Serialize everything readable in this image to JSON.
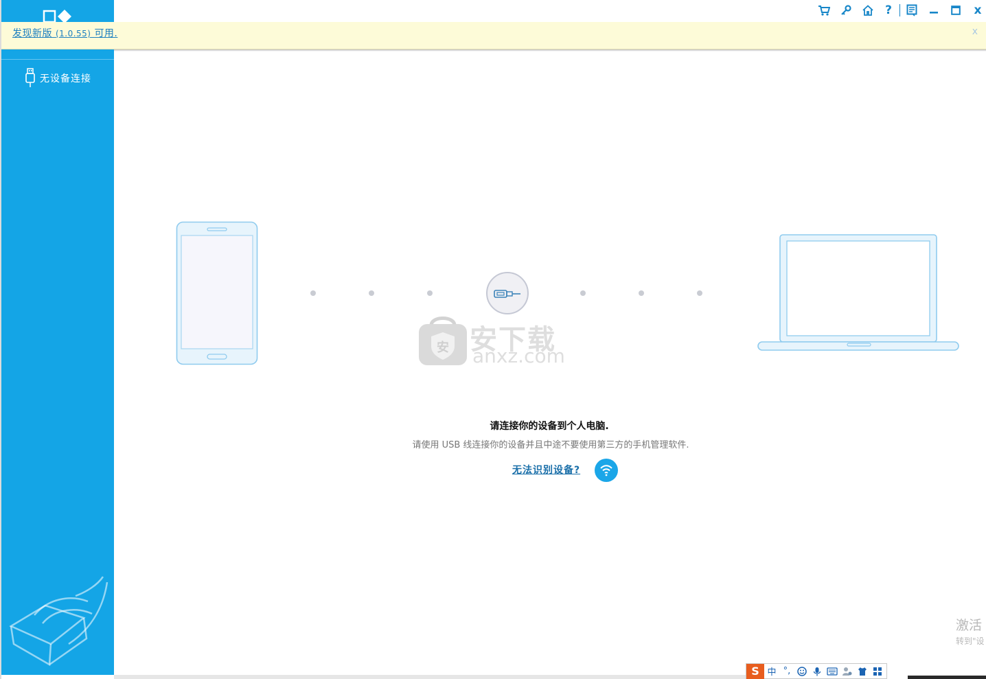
{
  "banner": {
    "text_main": "发现新版",
    "version": "(1.0.55)",
    "text_tail": "可用.",
    "close": "x"
  },
  "sidebar": {
    "device_status": "无设备连接"
  },
  "titlebar": {
    "help": "?",
    "close": "x",
    "icons": [
      "cart-icon",
      "key-icon",
      "home-icon",
      "help-icon",
      "feedback-icon",
      "minimize-icon",
      "maximize-icon",
      "close-icon"
    ]
  },
  "main": {
    "title": "请连接你的设备到个人电脑.",
    "subtitle": "请使用 USB 线连接你的设备并且中途不要使用第三方的手机管理软件.",
    "help_link": "无法识别设备?"
  },
  "watermark": {
    "cn": "安下载",
    "en": "anxz.com",
    "badge": "安"
  },
  "activate": {
    "line1": "激活",
    "line2": "转到\"设"
  },
  "ime": {
    "logo": "S",
    "mode": "中",
    "punct": "°,"
  },
  "colors": {
    "sidebar": "#14a5e6",
    "accent": "#1786c8",
    "banner_bg": "#fdfbd8",
    "link": "#1a6fa9"
  }
}
